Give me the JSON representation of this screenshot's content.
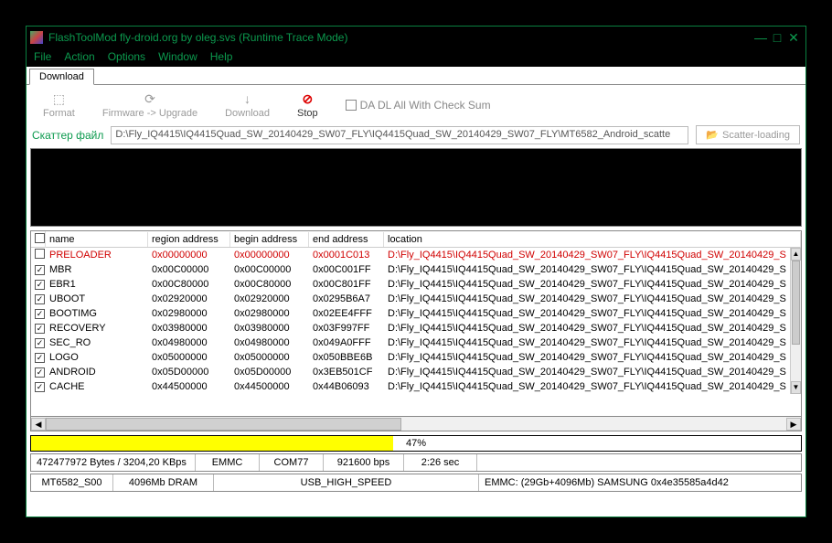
{
  "title": "FlashToolMod fly-droid.org by oleg.svs (Runtime Trace Mode)",
  "menu": {
    "file": "File",
    "action": "Action",
    "options": "Options",
    "window": "Window",
    "help": "Help"
  },
  "tabs": {
    "download": "Download"
  },
  "toolbar": {
    "format": "Format",
    "firmware_upgrade": "Firmware -> Upgrade",
    "download": "Download",
    "stop": "Stop",
    "da_dl_checksum": "DA DL All With Check Sum"
  },
  "scatter": {
    "label": "Скаттер файл",
    "path": "D:\\Fly_IQ4415\\IQ4415Quad_SW_20140429_SW07_FLY\\IQ4415Quad_SW_20140429_SW07_FLY\\MT6582_Android_scatte",
    "button": "Scatter-loading"
  },
  "table": {
    "headers": {
      "name": "name",
      "region": "region address",
      "begin": "begin address",
      "end": "end address",
      "location": "location"
    },
    "rows": [
      {
        "checked": false,
        "name": "PRELOADER",
        "region": "0x00000000",
        "begin": "0x00000000",
        "end": "0x0001C013",
        "location": "D:\\Fly_IQ4415\\IQ4415Quad_SW_20140429_SW07_FLY\\IQ4415Quad_SW_20140429_S",
        "red": true
      },
      {
        "checked": true,
        "name": "MBR",
        "region": "0x00C00000",
        "begin": "0x00C00000",
        "end": "0x00C001FF",
        "location": "D:\\Fly_IQ4415\\IQ4415Quad_SW_20140429_SW07_FLY\\IQ4415Quad_SW_20140429_S",
        "red": false
      },
      {
        "checked": true,
        "name": "EBR1",
        "region": "0x00C80000",
        "begin": "0x00C80000",
        "end": "0x00C801FF",
        "location": "D:\\Fly_IQ4415\\IQ4415Quad_SW_20140429_SW07_FLY\\IQ4415Quad_SW_20140429_S",
        "red": false
      },
      {
        "checked": true,
        "name": "UBOOT",
        "region": "0x02920000",
        "begin": "0x02920000",
        "end": "0x0295B6A7",
        "location": "D:\\Fly_IQ4415\\IQ4415Quad_SW_20140429_SW07_FLY\\IQ4415Quad_SW_20140429_S",
        "red": false
      },
      {
        "checked": true,
        "name": "BOOTIMG",
        "region": "0x02980000",
        "begin": "0x02980000",
        "end": "0x02EE4FFF",
        "location": "D:\\Fly_IQ4415\\IQ4415Quad_SW_20140429_SW07_FLY\\IQ4415Quad_SW_20140429_S",
        "red": false
      },
      {
        "checked": true,
        "name": "RECOVERY",
        "region": "0x03980000",
        "begin": "0x03980000",
        "end": "0x03F997FF",
        "location": "D:\\Fly_IQ4415\\IQ4415Quad_SW_20140429_SW07_FLY\\IQ4415Quad_SW_20140429_S",
        "red": false
      },
      {
        "checked": true,
        "name": "SEC_RO",
        "region": "0x04980000",
        "begin": "0x04980000",
        "end": "0x049A0FFF",
        "location": "D:\\Fly_IQ4415\\IQ4415Quad_SW_20140429_SW07_FLY\\IQ4415Quad_SW_20140429_S",
        "red": false
      },
      {
        "checked": true,
        "name": "LOGO",
        "region": "0x05000000",
        "begin": "0x05000000",
        "end": "0x050BBE6B",
        "location": "D:\\Fly_IQ4415\\IQ4415Quad_SW_20140429_SW07_FLY\\IQ4415Quad_SW_20140429_S",
        "red": false
      },
      {
        "checked": true,
        "name": "ANDROID",
        "region": "0x05D00000",
        "begin": "0x05D00000",
        "end": "0x3EB501CF",
        "location": "D:\\Fly_IQ4415\\IQ4415Quad_SW_20140429_SW07_FLY\\IQ4415Quad_SW_20140429_S",
        "red": false
      },
      {
        "checked": true,
        "name": "CACHE",
        "region": "0x44500000",
        "begin": "0x44500000",
        "end": "0x44B06093",
        "location": "D:\\Fly_IQ4415\\IQ4415Quad_SW_20140429_SW07_FLY\\IQ4415Quad_SW_20140429_S",
        "red": false
      }
    ]
  },
  "progress": {
    "percent": 47,
    "text": "47%"
  },
  "status1": {
    "bytes_speed": "472477972 Bytes / 3204,20 KBps",
    "storage": "EMMC",
    "com": "COM77",
    "baud": "921600 bps",
    "elapsed": "2:26 sec"
  },
  "status2": {
    "chip": "MT6582_S00",
    "dram": "4096Mb DRAM",
    "usb": "USB_HIGH_SPEED",
    "emmc": "EMMC: (29Gb+4096Mb) SAMSUNG 0x4e35585a4d42"
  }
}
